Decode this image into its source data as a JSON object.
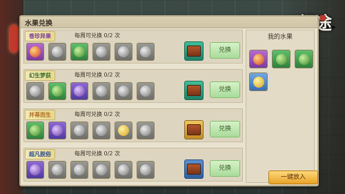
{
  "logo": {
    "text": "经途"
  },
  "panel": {
    "title": "水果兑换"
  },
  "rows": [
    {
      "tag": "香珍异果",
      "limit": "每周可兑换 0/2 次",
      "fruits": [
        "red",
        "gray",
        "green",
        "gray",
        "gray",
        "gray"
      ],
      "reward": "chest-teal",
      "button": "兑换"
    },
    {
      "tag": "幻生梦荻",
      "limit": "每周可兑换 0/2 次",
      "fruits": [
        "gray",
        "green",
        "purple",
        "gray",
        "gray",
        "gray"
      ],
      "reward": "chest-teal",
      "button": "兑换"
    },
    {
      "tag": "并蒂而生",
      "limit": "每周可兑换 0/2 次",
      "fruits": [
        "green",
        "purple",
        "gray",
        "gray",
        "yellow",
        "gray"
      ],
      "reward": "chest-gold",
      "button": "兑换"
    },
    {
      "tag": "超凡脱俗",
      "limit": "每周可兑换 0/2 次",
      "fruits": [
        "purple",
        "gray",
        "gray",
        "gray",
        "gray",
        "gray"
      ],
      "reward": "chest-blue",
      "button": "兑换"
    }
  ],
  "side": {
    "title": "我的水果",
    "put_button": "一键放入",
    "fruits": [
      {
        "icon": "red-fruit-icon",
        "color": "red"
      },
      {
        "icon": "cabbage-icon",
        "color": "green"
      },
      {
        "icon": "cabbage-icon",
        "color": "green"
      },
      {
        "icon": "pear-icon",
        "color": "yellow"
      }
    ]
  }
}
